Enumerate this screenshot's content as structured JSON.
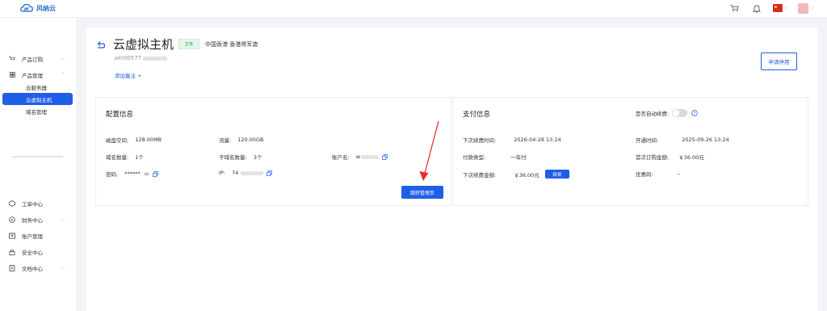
{
  "topbar": {
    "logo_text": "风纳云",
    "icons": [
      "cart-icon",
      "bell-icon",
      "china-flag-icon",
      "avatar"
    ]
  },
  "sidebar": {
    "items": [
      {
        "label": "产品订购",
        "icon": "cart-icon",
        "has_chevron": true
      },
      {
        "label": "产品管理",
        "icon": "grid-icon",
        "has_chevron": true,
        "expanded": true
      },
      {
        "label": "云服务器",
        "sub": true
      },
      {
        "label": "云虚拟主机",
        "sub": true,
        "active": true
      },
      {
        "label": "域名管理",
        "sub": true
      },
      {
        "label": "工单中心",
        "icon": "ticket-icon"
      },
      {
        "label": "财务中心",
        "icon": "finance-icon",
        "has_chevron": true
      },
      {
        "label": "账户管理",
        "icon": "account-icon"
      },
      {
        "label": "安全中心",
        "icon": "lock-icon"
      },
      {
        "label": "文档中心",
        "icon": "doc-icon",
        "has_chevron": true
      }
    ]
  },
  "header": {
    "title": "云虚拟主机",
    "status": "正常",
    "location": "中国香港 香港将军澳",
    "server_name": "ser00577",
    "add_note": "添加备注 +",
    "disable_button": "申请停用"
  },
  "config": {
    "title": "配置信息",
    "disk_label": "磁盘空间:",
    "disk_value": "128.00MB",
    "traffic_label": "流量:",
    "traffic_value": "120.00GB",
    "domains_label": "域名数量:",
    "domains_value": "1个",
    "subdomains_label": "子域名数量:",
    "subdomains_value": "3个",
    "account_label": "账户名:",
    "account_value": "w",
    "password_label": "密码:",
    "password_value": "******",
    "ip_label": "IP:",
    "ip_value": "74",
    "goto_button": "跳转管理页"
  },
  "payment": {
    "title": "支付信息",
    "auto_renew_label": "是否自动续费:",
    "auto_renew_on": false,
    "next_renew_time_label": "下次续费时间:",
    "next_renew_time_value": "2026-04-28 13:24",
    "open_time_label": "开通时间:",
    "open_time_value": "2025-09-26 13:24",
    "pay_type_label": "付款类型:",
    "pay_type_value": "一年付",
    "first_amount_label": "首次订购金额:",
    "first_amount_value": "￥36.00元",
    "next_amount_label": "下次续费金额:",
    "next_amount_value": "￥36.00元",
    "renew_button": "续费",
    "coupon_label": "优惠码:",
    "coupon_value": "--"
  },
  "colors": {
    "accent": "#1f5ee8",
    "status_green": "#2f9e5a",
    "arrow_red": "#e8322d"
  }
}
